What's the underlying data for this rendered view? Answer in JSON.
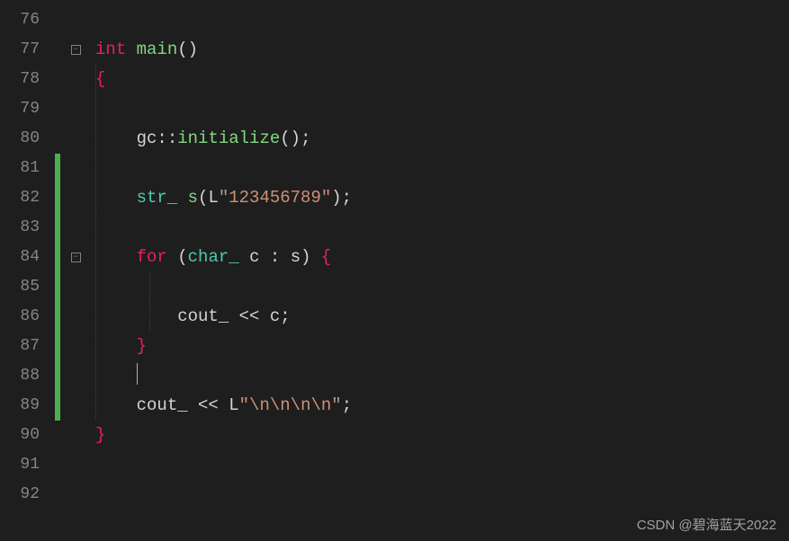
{
  "lines": {
    "start": 76,
    "end": 92
  },
  "modified_lines": [
    81,
    82,
    83,
    84,
    85,
    86,
    87,
    88,
    89
  ],
  "fold_markers": {
    "77": "-",
    "84": "-"
  },
  "code": {
    "l77": {
      "kw1": "int",
      "func": "main",
      "p1": "()"
    },
    "l78": {
      "brace": "{"
    },
    "l80": {
      "ns": "gc",
      "sep": "::",
      "fn": "initialize",
      "call": "()",
      "semi": ";"
    },
    "l82": {
      "type": "str_",
      "var": "s",
      "open": "(",
      "pfx": "L",
      "str": "\"123456789\"",
      "close": ")",
      "semi": ";"
    },
    "l84": {
      "kw": "for",
      "open": "(",
      "type": "char_",
      "var": "c",
      "colon": ":",
      "iter": "s",
      "close": ")",
      "brace": "{"
    },
    "l86": {
      "obj": "cout_",
      "op": "<<",
      "var": "c",
      "semi": ";"
    },
    "l87": {
      "brace": "}"
    },
    "l89": {
      "obj": "cout_",
      "op": "<<",
      "pfx": "L",
      "str": "\"\\n\\n\\n\\n\"",
      "semi": ";"
    },
    "l90": {
      "brace": "}"
    }
  },
  "watermark": "CSDN @碧海蓝天2022"
}
